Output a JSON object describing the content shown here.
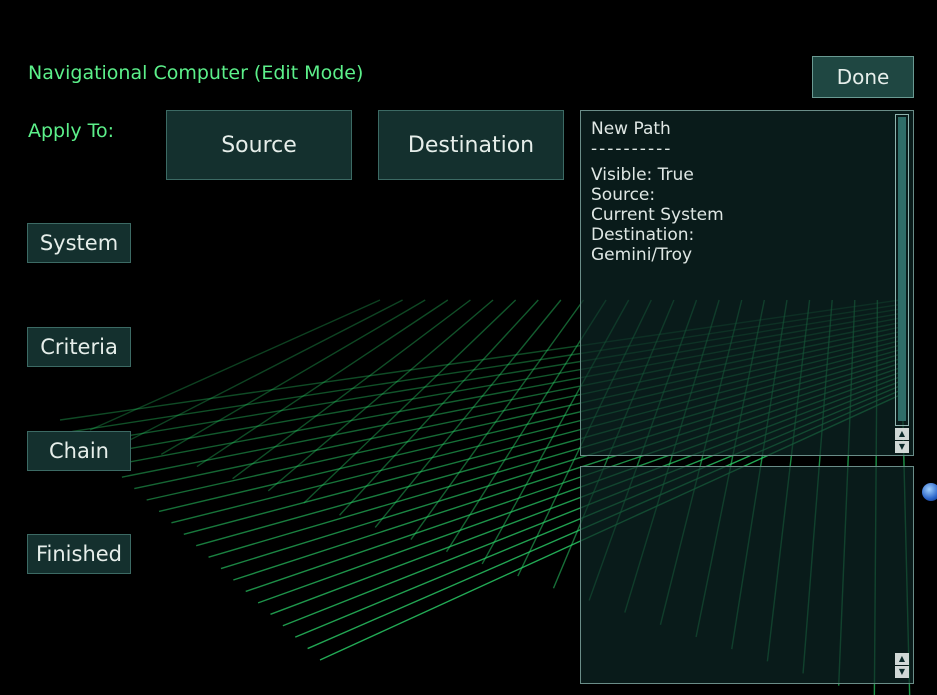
{
  "header": {
    "title": "Navigational Computer (Edit Mode)",
    "done_label": "Done"
  },
  "apply_to": {
    "label": "Apply To:",
    "source_label": "Source",
    "destination_label": "Destination"
  },
  "sidebar": {
    "items": [
      {
        "label": "System"
      },
      {
        "label": "Criteria"
      },
      {
        "label": "Chain"
      },
      {
        "label": "Finished"
      }
    ]
  },
  "info_panel": {
    "path_title": "New Path",
    "separator": "----------",
    "visible": "Visible: True",
    "source_label": "Source:",
    "source_value": "Current System",
    "destination_label": "Destination:",
    "destination_value": "Gemini/Troy"
  },
  "colors": {
    "title_green": "#5cf08a",
    "button_bg": "#14302e",
    "grid_green": "#2bd46a",
    "panel_border": "#6a8d88"
  },
  "icons": {
    "scroll_up": "scroll-up-icon",
    "scroll_down": "scroll-down-icon",
    "planet": "planet-icon"
  }
}
